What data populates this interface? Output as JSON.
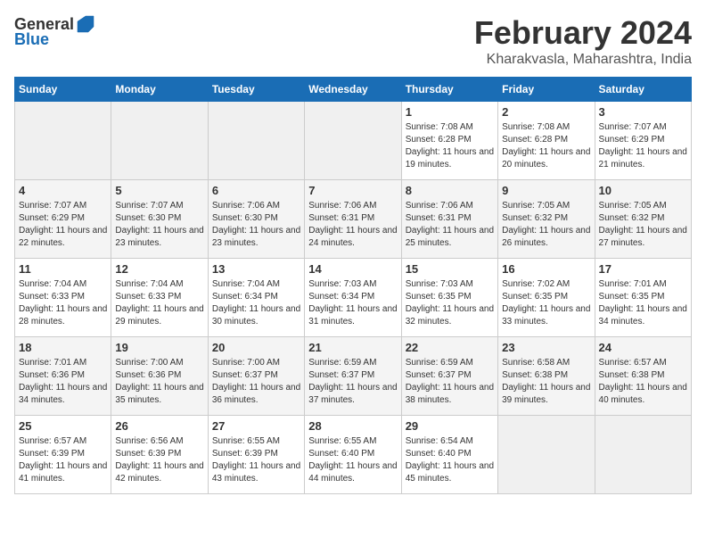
{
  "logo": {
    "general": "General",
    "blue": "Blue"
  },
  "title": {
    "month_year": "February 2024",
    "location": "Kharakvasla, Maharashtra, India"
  },
  "days_of_week": [
    "Sunday",
    "Monday",
    "Tuesday",
    "Wednesday",
    "Thursday",
    "Friday",
    "Saturday"
  ],
  "weeks": [
    [
      {
        "day": "",
        "empty": true
      },
      {
        "day": "",
        "empty": true
      },
      {
        "day": "",
        "empty": true
      },
      {
        "day": "",
        "empty": true
      },
      {
        "day": "1",
        "sunrise": "7:08 AM",
        "sunset": "6:28 PM",
        "daylight": "11 hours and 19 minutes."
      },
      {
        "day": "2",
        "sunrise": "7:08 AM",
        "sunset": "6:28 PM",
        "daylight": "11 hours and 20 minutes."
      },
      {
        "day": "3",
        "sunrise": "7:07 AM",
        "sunset": "6:29 PM",
        "daylight": "11 hours and 21 minutes."
      }
    ],
    [
      {
        "day": "4",
        "sunrise": "7:07 AM",
        "sunset": "6:29 PM",
        "daylight": "11 hours and 22 minutes."
      },
      {
        "day": "5",
        "sunrise": "7:07 AM",
        "sunset": "6:30 PM",
        "daylight": "11 hours and 23 minutes."
      },
      {
        "day": "6",
        "sunrise": "7:06 AM",
        "sunset": "6:30 PM",
        "daylight": "11 hours and 23 minutes."
      },
      {
        "day": "7",
        "sunrise": "7:06 AM",
        "sunset": "6:31 PM",
        "daylight": "11 hours and 24 minutes."
      },
      {
        "day": "8",
        "sunrise": "7:06 AM",
        "sunset": "6:31 PM",
        "daylight": "11 hours and 25 minutes."
      },
      {
        "day": "9",
        "sunrise": "7:05 AM",
        "sunset": "6:32 PM",
        "daylight": "11 hours and 26 minutes."
      },
      {
        "day": "10",
        "sunrise": "7:05 AM",
        "sunset": "6:32 PM",
        "daylight": "11 hours and 27 minutes."
      }
    ],
    [
      {
        "day": "11",
        "sunrise": "7:04 AM",
        "sunset": "6:33 PM",
        "daylight": "11 hours and 28 minutes."
      },
      {
        "day": "12",
        "sunrise": "7:04 AM",
        "sunset": "6:33 PM",
        "daylight": "11 hours and 29 minutes."
      },
      {
        "day": "13",
        "sunrise": "7:04 AM",
        "sunset": "6:34 PM",
        "daylight": "11 hours and 30 minutes."
      },
      {
        "day": "14",
        "sunrise": "7:03 AM",
        "sunset": "6:34 PM",
        "daylight": "11 hours and 31 minutes."
      },
      {
        "day": "15",
        "sunrise": "7:03 AM",
        "sunset": "6:35 PM",
        "daylight": "11 hours and 32 minutes."
      },
      {
        "day": "16",
        "sunrise": "7:02 AM",
        "sunset": "6:35 PM",
        "daylight": "11 hours and 33 minutes."
      },
      {
        "day": "17",
        "sunrise": "7:01 AM",
        "sunset": "6:35 PM",
        "daylight": "11 hours and 34 minutes."
      }
    ],
    [
      {
        "day": "18",
        "sunrise": "7:01 AM",
        "sunset": "6:36 PM",
        "daylight": "11 hours and 34 minutes."
      },
      {
        "day": "19",
        "sunrise": "7:00 AM",
        "sunset": "6:36 PM",
        "daylight": "11 hours and 35 minutes."
      },
      {
        "day": "20",
        "sunrise": "7:00 AM",
        "sunset": "6:37 PM",
        "daylight": "11 hours and 36 minutes."
      },
      {
        "day": "21",
        "sunrise": "6:59 AM",
        "sunset": "6:37 PM",
        "daylight": "11 hours and 37 minutes."
      },
      {
        "day": "22",
        "sunrise": "6:59 AM",
        "sunset": "6:37 PM",
        "daylight": "11 hours and 38 minutes."
      },
      {
        "day": "23",
        "sunrise": "6:58 AM",
        "sunset": "6:38 PM",
        "daylight": "11 hours and 39 minutes."
      },
      {
        "day": "24",
        "sunrise": "6:57 AM",
        "sunset": "6:38 PM",
        "daylight": "11 hours and 40 minutes."
      }
    ],
    [
      {
        "day": "25",
        "sunrise": "6:57 AM",
        "sunset": "6:39 PM",
        "daylight": "11 hours and 41 minutes."
      },
      {
        "day": "26",
        "sunrise": "6:56 AM",
        "sunset": "6:39 PM",
        "daylight": "11 hours and 42 minutes."
      },
      {
        "day": "27",
        "sunrise": "6:55 AM",
        "sunset": "6:39 PM",
        "daylight": "11 hours and 43 minutes."
      },
      {
        "day": "28",
        "sunrise": "6:55 AM",
        "sunset": "6:40 PM",
        "daylight": "11 hours and 44 minutes."
      },
      {
        "day": "29",
        "sunrise": "6:54 AM",
        "sunset": "6:40 PM",
        "daylight": "11 hours and 45 minutes."
      },
      {
        "day": "",
        "empty": true
      },
      {
        "day": "",
        "empty": true
      }
    ]
  ],
  "labels": {
    "sunrise": "Sunrise:",
    "sunset": "Sunset:",
    "daylight": "Daylight:"
  }
}
